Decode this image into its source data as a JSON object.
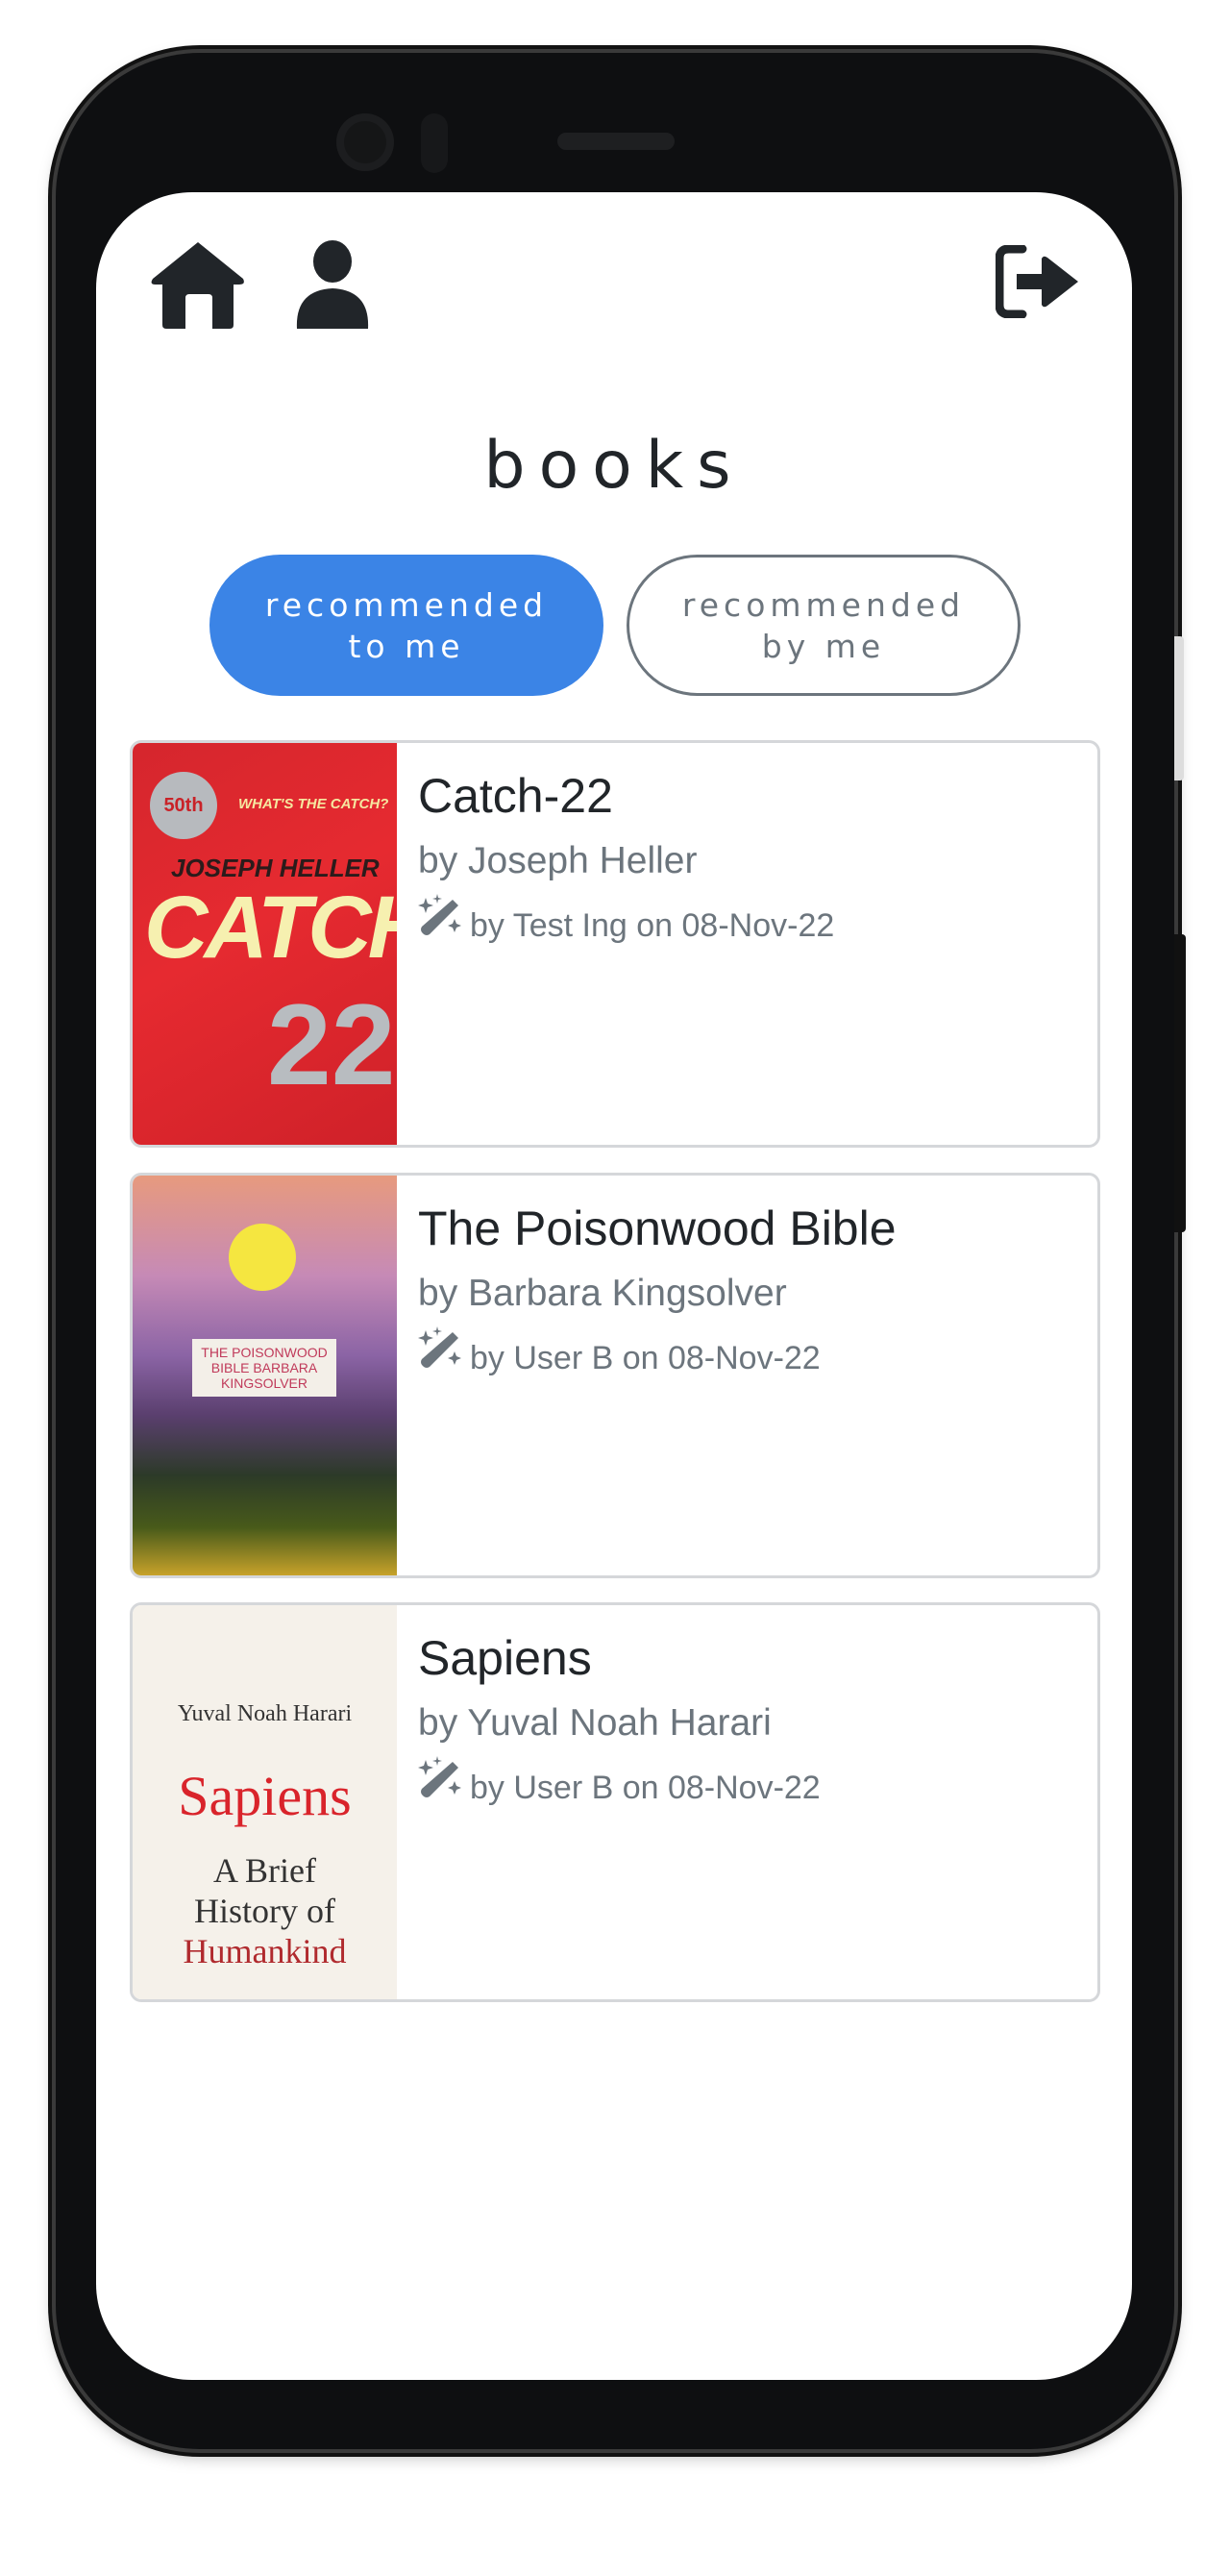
{
  "header": {
    "title": "books",
    "icons": [
      "home-icon",
      "user-icon",
      "sign-out-icon"
    ]
  },
  "tabs": [
    {
      "label_line1": "recommended",
      "label_line2": "to me",
      "active": true
    },
    {
      "label_line1": "recommended",
      "label_line2": "by me",
      "active": false
    }
  ],
  "colors": {
    "accent": "#3b84e6",
    "text": "#212529",
    "muted": "#6c757d"
  },
  "books": [
    {
      "title": "Catch-22",
      "author": "by Joseph Heller",
      "meta": "by Test Ing on 08-Nov-22",
      "cover": {
        "top": "WHAT'S THE CATCH?",
        "author": "JOSEPH HELLER",
        "word": "CATCH",
        "num": "22",
        "badge": "50th"
      }
    },
    {
      "title": "The Poisonwood Bible",
      "author": "by Barbara Kingsolver",
      "meta": "by User B on 08-Nov-22",
      "cover": {
        "label": "THE POISONWOOD BIBLE BARBARA KINGSOLVER"
      }
    },
    {
      "title": "Sapiens",
      "author": "by Yuval Noah Harari",
      "meta": "by User B on 08-Nov-22",
      "cover": {
        "author": "Yuval Noah Harari",
        "word": "Sapiens",
        "sub1": "A Brief",
        "sub2": "History of",
        "sub3": "Humankind"
      }
    }
  ]
}
